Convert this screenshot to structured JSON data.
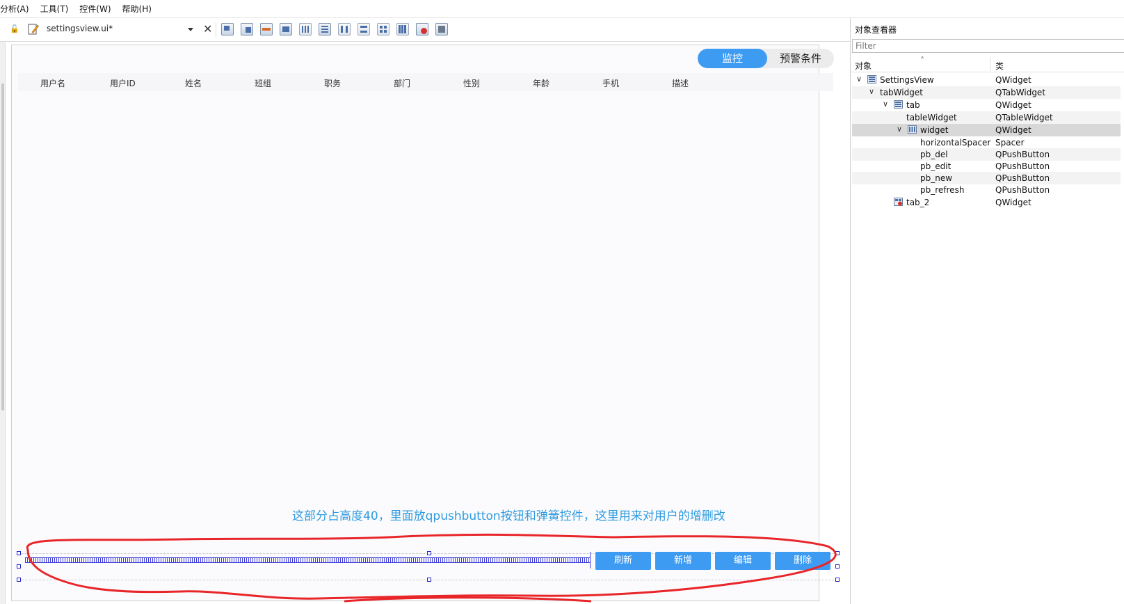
{
  "menu": [
    "分析(A)",
    "工具(T)",
    "控件(W)",
    "帮助(H)"
  ],
  "toolbar": {
    "file_name": "settingsview.ui*"
  },
  "tabs": {
    "active": "监控",
    "inactive": "预警条件"
  },
  "table": {
    "headers": [
      "用户名",
      "用户ID",
      "姓名",
      "班组",
      "职务",
      "部门",
      "性别",
      "年龄",
      "手机",
      "描述"
    ]
  },
  "annotation": "这部分占高度40，里面放qpushbutton按钮和弹簧控件，这里用来对用户的增删改",
  "buttons": {
    "refresh": "刷新",
    "new": "新增",
    "edit": "编辑",
    "delete": "删除"
  },
  "inspector": {
    "title": "对象查看器",
    "filter_placeholder": "Filter",
    "col_object": "对象",
    "col_class": "类",
    "rows": [
      {
        "obj": "SettingsView",
        "cls": "QWidget"
      },
      {
        "obj": "tabWidget",
        "cls": "QTabWidget"
      },
      {
        "obj": "tab",
        "cls": "QWidget"
      },
      {
        "obj": "tableWidget",
        "cls": "QTableWidget"
      },
      {
        "obj": "widget",
        "cls": "QWidget"
      },
      {
        "obj": "horizontalSpacer",
        "cls": "Spacer"
      },
      {
        "obj": "pb_del",
        "cls": "QPushButton"
      },
      {
        "obj": "pb_edit",
        "cls": "QPushButton"
      },
      {
        "obj": "pb_new",
        "cls": "QPushButton"
      },
      {
        "obj": "pb_refresh",
        "cls": "QPushButton"
      },
      {
        "obj": "tab_2",
        "cls": "QWidget"
      }
    ]
  },
  "colors": {
    "accent": "#3d9bf2",
    "annotation_text": "#2f9be0",
    "annotation_stroke": "#e8262a",
    "spacer": "#3a3ad8"
  }
}
